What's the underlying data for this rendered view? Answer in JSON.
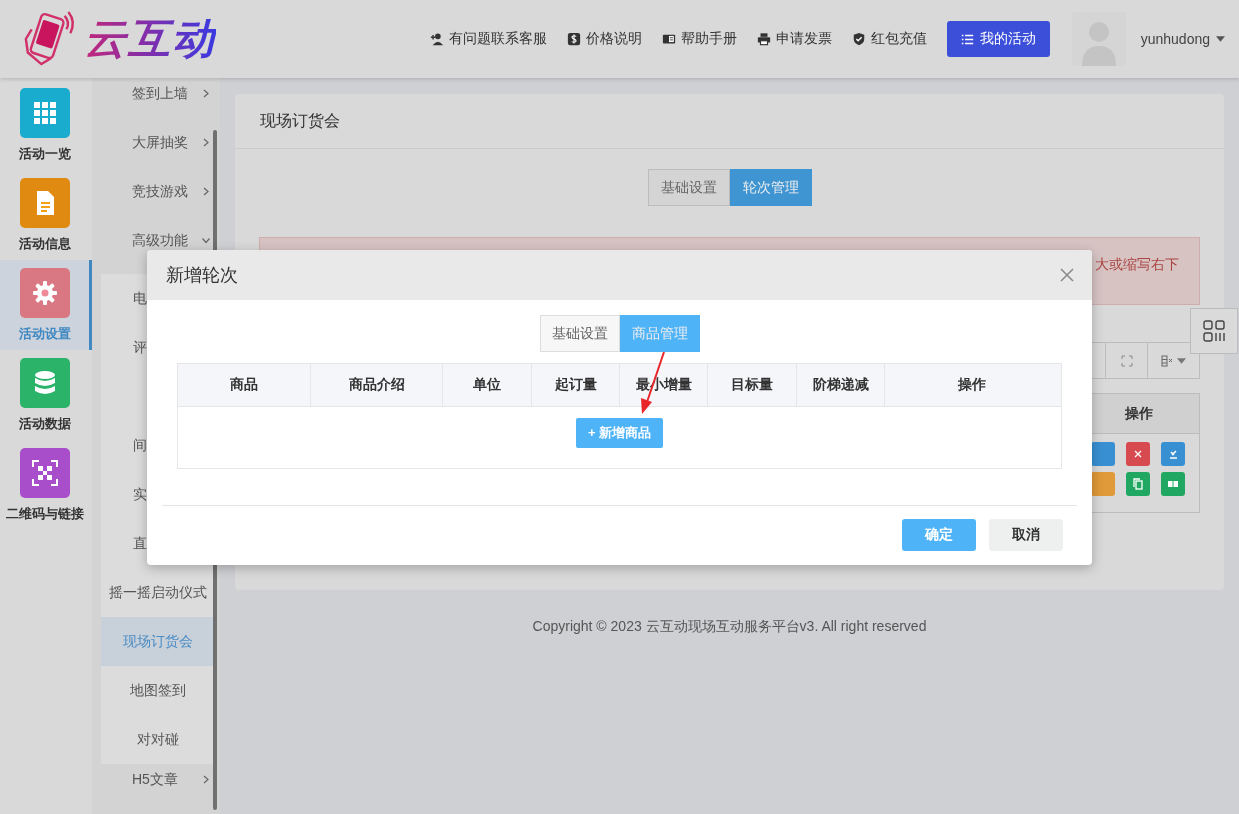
{
  "header": {
    "logo_text": "云互动",
    "links": [
      {
        "label": "有问题联系客服"
      },
      {
        "label": "价格说明"
      },
      {
        "label": "帮助手册"
      },
      {
        "label": "申请发票"
      },
      {
        "label": "红包充值"
      }
    ],
    "my_activities": "我的活动",
    "username": "yunhudong"
  },
  "sidebar": {
    "items": [
      {
        "label": "活动一览",
        "color": "#1aaccf",
        "selected": false
      },
      {
        "label": "活动信息",
        "color": "#e08a12",
        "selected": false
      },
      {
        "label": "活动设置",
        "color": "#d97882",
        "selected": true
      },
      {
        "label": "活动数据",
        "color": "#2bb36a",
        "selected": false
      },
      {
        "label": "二维码与链接",
        "color": "#a94ecb",
        "selected": false
      }
    ]
  },
  "submenu": {
    "items": [
      {
        "label": "签到上墙",
        "expanded": false
      },
      {
        "label": "大屏抽奖",
        "expanded": false
      },
      {
        "label": "竞技游戏",
        "expanded": false
      },
      {
        "label": "高级功能",
        "expanded": true,
        "children": [
          {
            "label": "电",
            "kind": "cut",
            "selected": false
          },
          {
            "label": "评",
            "kind": "cut",
            "selected": false
          },
          {
            "kind": "covered"
          },
          {
            "label": "间",
            "kind": "cut",
            "selected": false
          },
          {
            "label": "实",
            "kind": "cut",
            "selected": false
          },
          {
            "label": "直",
            "kind": "cut",
            "selected": false
          },
          {
            "label": "摇一摇启动仪式",
            "kind": "full",
            "selected": false
          },
          {
            "label": "现场订货会",
            "kind": "full",
            "selected": true
          },
          {
            "label": "地图签到",
            "kind": "full",
            "selected": false
          },
          {
            "label": "对对碰",
            "kind": "full",
            "selected": false
          }
        ]
      },
      {
        "label": "H5文章",
        "expanded": false
      }
    ]
  },
  "page": {
    "title": "现场订货会",
    "tabs": [
      {
        "label": "基础设置",
        "selected": false
      },
      {
        "label": "轮次管理",
        "selected": true
      }
    ],
    "alert_text": "大或缩写右下",
    "table": {
      "columns": [
        "操作"
      ],
      "action_rows": [
        [
          {
            "color": "#3890d2"
          },
          {
            "color": "#d74a4f"
          },
          {
            "color": "#3890d2"
          }
        ],
        [
          {
            "color": "#e09a3a"
          },
          {
            "color": "#20a862"
          },
          {
            "color": "#20a862"
          }
        ]
      ]
    }
  },
  "footer": "Copyright © 2023 云互动现场互动服务平台v3. All right reserved",
  "modal": {
    "title": "新增轮次",
    "tabs": [
      {
        "label": "基础设置",
        "selected": false
      },
      {
        "label": "商品管理",
        "selected": true
      }
    ],
    "table": {
      "columns": [
        "商品",
        "商品介绍",
        "单位",
        "起订量",
        "最小增量",
        "目标量",
        "阶梯递减",
        "操作"
      ],
      "add_button": "+ 新增商品"
    },
    "buttons": [
      {
        "label": "确定",
        "kind": "primary"
      },
      {
        "label": "取消",
        "kind": "default"
      }
    ]
  }
}
